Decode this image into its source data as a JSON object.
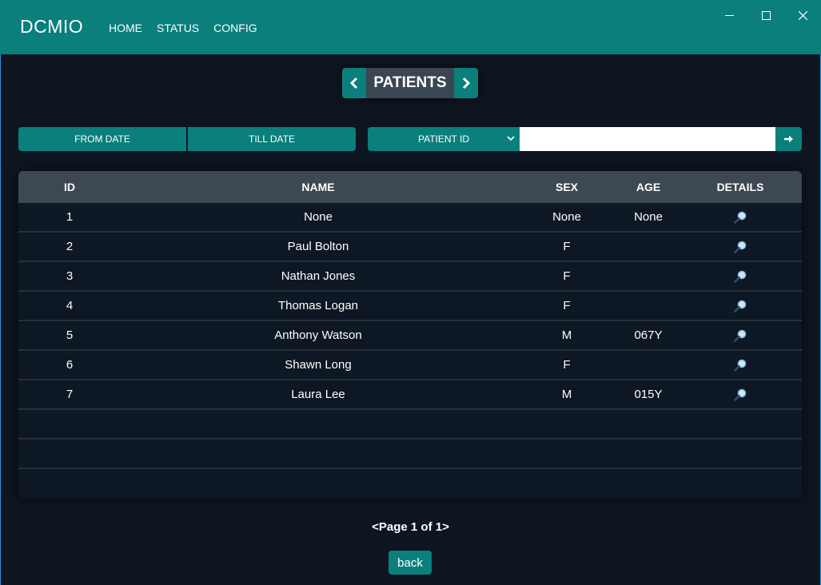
{
  "app": {
    "brand": "DCMIO",
    "nav": [
      "HOME",
      "STATUS",
      "CONFIG"
    ],
    "accent_color": "#0a7f7c",
    "background_color": "#0d1520"
  },
  "window_controls": {
    "minimize_icon": "minimize-icon",
    "maximize_icon": "maximize-icon",
    "close_icon": "close-icon"
  },
  "pager_header": {
    "title": "PATIENTS",
    "prev_icon": "chevron-left-icon",
    "next_icon": "chevron-right-icon"
  },
  "filters": {
    "from_date_label": "FROM DATE",
    "till_date_label": "TILL DATE",
    "field_select_value": "PATIENT ID",
    "search_value": "",
    "go_icon": "arrow-right-icon"
  },
  "table": {
    "columns": [
      "ID",
      "NAME",
      "SEX",
      "AGE",
      "DETAILS"
    ],
    "rows": [
      {
        "id": "1",
        "name": "None",
        "sex": "None",
        "age": "None"
      },
      {
        "id": "2",
        "name": "Paul Bolton",
        "sex": "F",
        "age": ""
      },
      {
        "id": "3",
        "name": "Nathan Jones",
        "sex": "F",
        "age": ""
      },
      {
        "id": "4",
        "name": "Thomas Logan",
        "sex": "F",
        "age": ""
      },
      {
        "id": "5",
        "name": "Anthony Watson",
        "sex": "M",
        "age": "067Y"
      },
      {
        "id": "6",
        "name": "Shawn Long",
        "sex": "F",
        "age": ""
      },
      {
        "id": "7",
        "name": "Laura Lee",
        "sex": "M",
        "age": "015Y"
      }
    ],
    "details_icon": "magnifier-icon"
  },
  "pagination": {
    "label": "<Page 1 of 1>"
  },
  "back_button": {
    "label": "back"
  }
}
